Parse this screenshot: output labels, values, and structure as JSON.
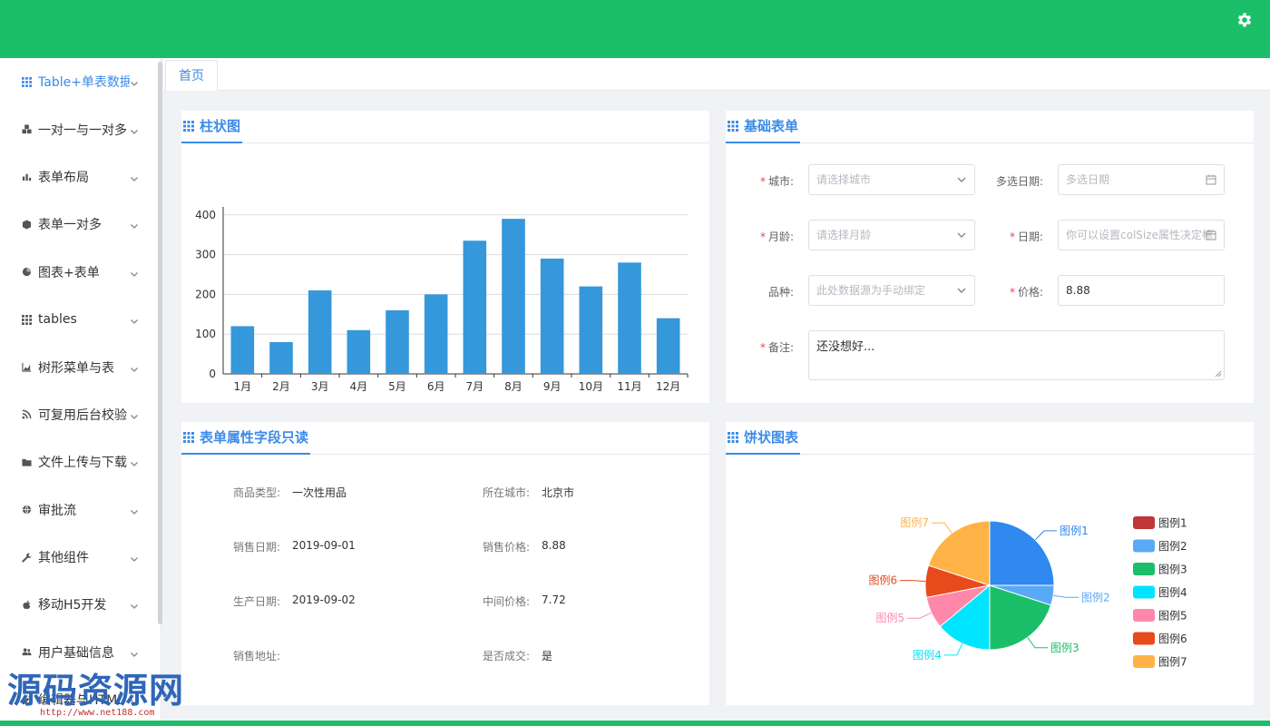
{
  "sidebar": {
    "items": [
      {
        "label": "Table+单表数据",
        "icon": "grid-icon",
        "active": true
      },
      {
        "label": "一对一与一对多",
        "icon": "cubes-icon"
      },
      {
        "label": "表单布局",
        "icon": "bar-chart-icon"
      },
      {
        "label": "表单一对多",
        "icon": "cube-icon"
      },
      {
        "label": "图表+表单",
        "icon": "pie-chart-icon"
      },
      {
        "label": "tables",
        "icon": "grid-icon"
      },
      {
        "label": "树形菜单与表",
        "icon": "area-chart-icon"
      },
      {
        "label": "可复用后台校验",
        "icon": "rss-icon"
      },
      {
        "label": "文件上传与下载",
        "icon": "folder-icon"
      },
      {
        "label": "审批流",
        "icon": "globe-icon"
      },
      {
        "label": "其他组件",
        "icon": "wrench-icon"
      },
      {
        "label": "移动H5开发",
        "icon": "apple-icon"
      },
      {
        "label": "用户基础信息",
        "icon": "users-icon"
      },
      {
        "label": "编辑器与HTML",
        "icon": "editor-icon"
      }
    ]
  },
  "tabs": [
    {
      "label": "首页"
    }
  ],
  "bar_card": {
    "title": "柱状图"
  },
  "chart_data": {
    "type": "bar",
    "categories": [
      "1月",
      "2月",
      "3月",
      "4月",
      "5月",
      "6月",
      "7月",
      "8月",
      "9月",
      "10月",
      "11月",
      "12月"
    ],
    "values": [
      120,
      80,
      210,
      110,
      160,
      200,
      335,
      390,
      290,
      220,
      280,
      140
    ],
    "yticks": [
      0,
      100,
      200,
      300,
      400
    ],
    "ylim": [
      0,
      420
    ],
    "grid": true,
    "bar_color": "#3498db"
  },
  "form_card": {
    "title": "基础表单",
    "city_label": "城市:",
    "city_placeholder": "请选择城市",
    "multi_date_label": "多选日期:",
    "multi_date_placeholder": "多选日期",
    "age_label": "月龄:",
    "age_placeholder": "请选择月龄",
    "date_label": "日期:",
    "date_placeholder": "你可以设置colSize属性决定标",
    "breed_label": "品种:",
    "breed_placeholder": "此处数据源为手动绑定",
    "price_label": "价格:",
    "price_value": "8.88",
    "note_label": "备注:",
    "note_value": "还没想好..."
  },
  "readonly_card": {
    "title": "表单属性字段只读",
    "fields": [
      {
        "label": "商品类型:",
        "value": "一次性用品"
      },
      {
        "label": "所在城市:",
        "value": "北京市"
      },
      {
        "label": "销售日期:",
        "value": "2019-09-01"
      },
      {
        "label": "销售价格:",
        "value": "8.88"
      },
      {
        "label": "生产日期:",
        "value": "2019-09-02"
      },
      {
        "label": "中间价格:",
        "value": "7.72"
      },
      {
        "label": "销售地址:",
        "value": ""
      },
      {
        "label": "是否成交:",
        "value": "是"
      }
    ]
  },
  "pie_card": {
    "title": "饼状图表",
    "slices": [
      {
        "name": "图例1",
        "value": 25,
        "color": "#2f89ee"
      },
      {
        "name": "图例2",
        "value": 5,
        "color": "#5aa9f5"
      },
      {
        "name": "图例3",
        "value": 20,
        "color": "#1bbf6a"
      },
      {
        "name": "图例4",
        "value": 14,
        "color": "#00e5ff"
      },
      {
        "name": "图例5",
        "value": 8,
        "color": "#ff88aa"
      },
      {
        "name": "图例6",
        "value": 8,
        "color": "#e84a1c"
      },
      {
        "name": "图例7",
        "value": 20,
        "color": "#ffb347"
      }
    ],
    "legend_swatches": [
      "#c03535",
      "#5aa9f5",
      "#1bbf6a",
      "#00e5ff",
      "#ff88aa",
      "#e84a1c",
      "#ffb347"
    ]
  },
  "watermark": {
    "text": "源码资源网",
    "url": "http://www.net188.com"
  }
}
